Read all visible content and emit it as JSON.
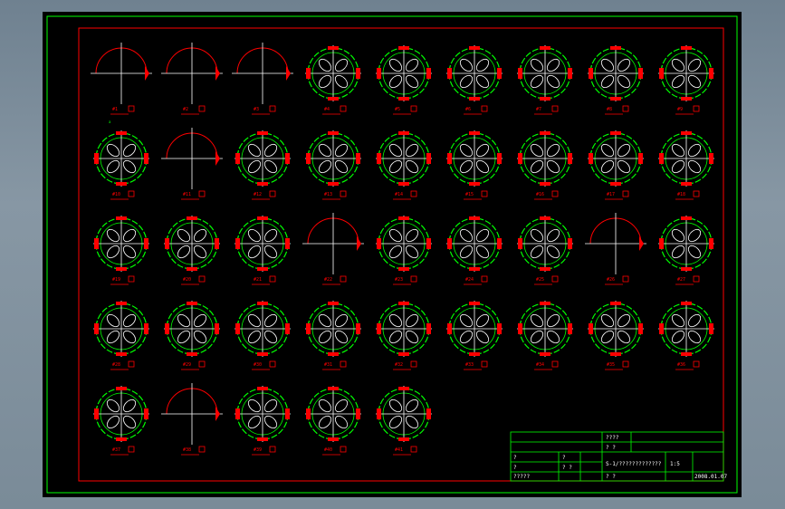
{
  "colors": {
    "background": "#000000",
    "outer_frame": "#00ff00",
    "inner_frame": "#ff0000",
    "outline": "#00ff00",
    "center_lines": "#ffffff",
    "feature": "#ff0000"
  },
  "parts": [
    {
      "label": "#1",
      "note": "a"
    },
    {
      "label": "#2",
      "note": ""
    },
    {
      "label": "#3",
      "note": ""
    },
    {
      "label": "#4",
      "note": ""
    },
    {
      "label": "#5",
      "note": ""
    },
    {
      "label": "#6",
      "note": ""
    },
    {
      "label": "#7",
      "note": ""
    },
    {
      "label": "#8",
      "note": ""
    },
    {
      "label": "#9",
      "note": ""
    },
    {
      "label": "#10",
      "note": ""
    },
    {
      "label": "#11",
      "note": ""
    },
    {
      "label": "#12",
      "note": ""
    },
    {
      "label": "#13",
      "note": ""
    },
    {
      "label": "#14",
      "note": ""
    },
    {
      "label": "#15",
      "note": ""
    },
    {
      "label": "#16",
      "note": ""
    },
    {
      "label": "#17",
      "note": ""
    },
    {
      "label": "#18",
      "note": ""
    },
    {
      "label": "#19",
      "note": ""
    },
    {
      "label": "#20",
      "note": ""
    },
    {
      "label": "#21",
      "note": ""
    },
    {
      "label": "#22",
      "note": ""
    },
    {
      "label": "#23",
      "note": ""
    },
    {
      "label": "#24",
      "note": ""
    },
    {
      "label": "#25",
      "note": ""
    },
    {
      "label": "#26",
      "note": ""
    },
    {
      "label": "#27",
      "note": ""
    },
    {
      "label": "#28",
      "note": ""
    },
    {
      "label": "#29",
      "note": ""
    },
    {
      "label": "#30",
      "note": ""
    },
    {
      "label": "#31",
      "note": ""
    },
    {
      "label": "#32",
      "note": ""
    },
    {
      "label": "#33",
      "note": ""
    },
    {
      "label": "#34",
      "note": ""
    },
    {
      "label": "#35",
      "note": ""
    },
    {
      "label": "#36",
      "note": ""
    },
    {
      "label": "#37",
      "note": ""
    },
    {
      "label": "#38",
      "note": ""
    },
    {
      "label": "#39",
      "note": ""
    },
    {
      "label": "#40",
      "note": ""
    },
    {
      "label": "#41",
      "note": ""
    }
  ],
  "title_block": {
    "header_top": "????",
    "header_sub": "? ?",
    "drawing_title": "S-1/?????????????",
    "scale": "1:5",
    "date": "2008.01.07",
    "cell_q": "?",
    "cell_qq": "? ?",
    "cell_five": "?????"
  }
}
